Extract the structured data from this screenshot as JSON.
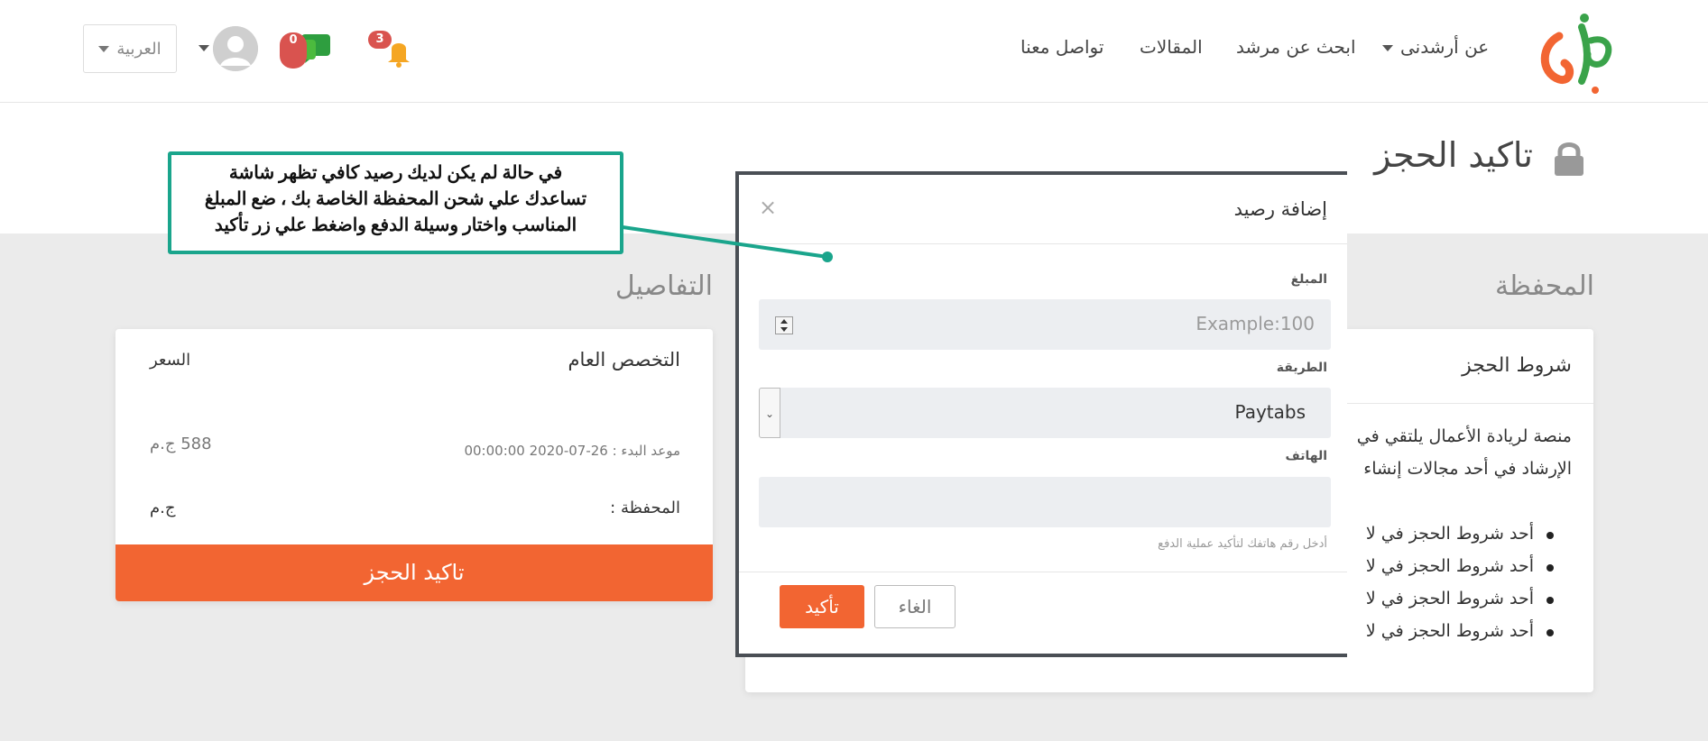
{
  "header": {
    "nav": {
      "about": "عن أرشدنى",
      "find_mentor": "ابحث عن مرشد",
      "articles": "المقالات",
      "contact": "تواصل معنا"
    },
    "language": "العربية",
    "messages_count": "0",
    "notifications_count": "3",
    "logo_icon": "arshedni-logo"
  },
  "page": {
    "title": "تاكيد الحجز"
  },
  "details": {
    "section_title": "التفاصيل",
    "specialty_header": "التخصص العام",
    "price_header": "السعر",
    "start_label": "موعد البدء : 26-07-2020 00:00:00",
    "price_value": "588 ج.م",
    "wallet_label": "المحفظة :",
    "wallet_value": "ج.م",
    "confirm_button": "تاكيد الحجز"
  },
  "wallet": {
    "section_title": "المحفظة",
    "terms_title": "شروط الحجز",
    "paragraph_line1": "منصة لريادة الأعمال يلتقي في",
    "paragraph_line2": "الإرشاد في أحد مجالات إنشاء",
    "items": [
      "أحد شروط الحجز في لا",
      "أحد شروط الحجز في لا",
      "أحد شروط الحجز في لا",
      "أحد شروط الحجز في لا"
    ]
  },
  "modal": {
    "title": "إضافة رصيد",
    "amount_label": "المبلغ",
    "amount_placeholder": "Example:100",
    "method_label": "الطريقة",
    "method_value": "Paytabs",
    "phone_label": "الهاتف",
    "phone_hint": "أدخل رقم هاتفك لتأكيد عملية الدفع",
    "cancel_button": "الغاء",
    "confirm_button": "تأكيد"
  },
  "callout": {
    "line1": "في حالة لم يكن لديك رصيد كافي  تظهر شاشة",
    "line2": "تساعدك علي شحن المحفظة الخاصة بك ، ضع المبلغ",
    "line3": "المناسب واختار وسيلة الدفع واضغط علي زر تأكيد"
  },
  "colors": {
    "accent": "#f26532",
    "callout_border": "#1aa58c",
    "badge": "#d9534f"
  }
}
